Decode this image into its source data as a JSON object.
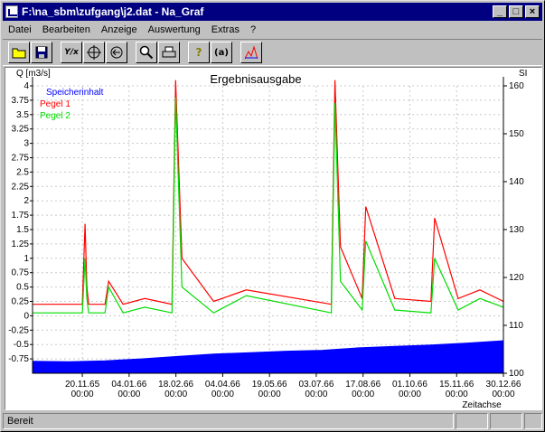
{
  "window": {
    "title": "F:\\na_sbm\\zufgang\\j2.dat - Na_Graf",
    "minimize_icon": "minimize-icon",
    "maximize_icon": "maximize-icon",
    "close_icon": "close-icon"
  },
  "menu": {
    "items": [
      "Datei",
      "Bearbeiten",
      "Anzeige",
      "Auswertung",
      "Extras",
      "?"
    ]
  },
  "toolbar": {
    "icons": [
      "open-folder-icon",
      "save-icon",
      "yx-icon",
      "crosshair-icon",
      "back-arrow-icon",
      "zoom-icon",
      "print-icon",
      "help-icon",
      "about-icon",
      "graph-icon"
    ],
    "yx_label": "Y/x",
    "help_label": "?",
    "about_label": "(a)"
  },
  "status": {
    "text": "Bereit"
  },
  "chart_data": {
    "type": "line",
    "title": "Ergebnisausgabe",
    "ylabel_left": "Q [m3/s]",
    "ylabel_right": "SI",
    "xlabel": "Zeitachse",
    "ylim_left": [
      -1.0,
      4.0
    ],
    "ylim_right": [
      100,
      160
    ],
    "yticks_left": [
      "4",
      "3.75",
      "3.5",
      "3.25",
      "3",
      "2.75",
      "2.5",
      "2.25",
      "2",
      "1.75",
      "1.5",
      "1.25",
      "1",
      "0.75",
      "0.5",
      "0.25",
      "0",
      "-0.25",
      "-0.5",
      "-0.75"
    ],
    "yticks_right": [
      "160",
      "150",
      "140",
      "130",
      "120",
      "110",
      "100"
    ],
    "xticks": [
      {
        "date": "20.11.65",
        "time": "00:00"
      },
      {
        "date": "04.01.66",
        "time": "00:00"
      },
      {
        "date": "18.02.66",
        "time": "00:00"
      },
      {
        "date": "04.04.66",
        "time": "00:00"
      },
      {
        "date": "19.05.66",
        "time": "00:00"
      },
      {
        "date": "03.07.66",
        "time": "00:00"
      },
      {
        "date": "17.08.66",
        "time": "00:00"
      },
      {
        "date": "01.10.66",
        "time": "00:00"
      },
      {
        "date": "15.11.66",
        "time": "00:00"
      },
      {
        "date": "30.12.66",
        "time": "00:00"
      }
    ],
    "grid": true,
    "legend_position": "top-left",
    "series": [
      {
        "name": "Speicherinhalt",
        "axis": "right",
        "style": "area",
        "color": "#0000ff",
        "x": [
          0,
          40,
          80,
          120,
          160,
          200,
          240,
          280,
          320,
          360,
          400,
          440,
          480,
          520
        ],
        "y": [
          102.5,
          102.4,
          102.6,
          103.0,
          103.5,
          104.0,
          104.3,
          104.6,
          104.8,
          105.3,
          105.6,
          105.9,
          106.3,
          106.8
        ]
      },
      {
        "name": "Pegel 1",
        "axis": "left",
        "color": "#ff0000",
        "x": [
          0,
          55,
          58,
          60,
          62,
          80,
          84,
          100,
          124,
          154,
          158,
          165,
          200,
          236,
          330,
          334,
          340,
          364,
          368,
          400,
          440,
          444,
          470,
          494,
          520
        ],
        "y": [
          0.2,
          0.2,
          1.6,
          0.5,
          0.2,
          0.2,
          0.6,
          0.2,
          0.3,
          0.2,
          4.1,
          1.0,
          0.25,
          0.45,
          0.2,
          4.1,
          1.2,
          0.3,
          1.9,
          0.3,
          0.25,
          1.7,
          0.3,
          0.45,
          0.25
        ]
      },
      {
        "name": "Pegel 2",
        "axis": "left",
        "color": "#00dd00",
        "x": [
          0,
          55,
          58,
          60,
          62,
          80,
          84,
          100,
          124,
          154,
          158,
          165,
          200,
          236,
          330,
          334,
          340,
          364,
          368,
          400,
          440,
          444,
          470,
          494,
          520
        ],
        "y": [
          0.05,
          0.05,
          1.0,
          0.3,
          0.05,
          0.05,
          0.5,
          0.05,
          0.15,
          0.05,
          3.8,
          0.5,
          0.05,
          0.35,
          0.05,
          3.7,
          0.6,
          0.1,
          1.3,
          0.1,
          0.05,
          1.0,
          0.1,
          0.3,
          0.15
        ]
      }
    ]
  }
}
